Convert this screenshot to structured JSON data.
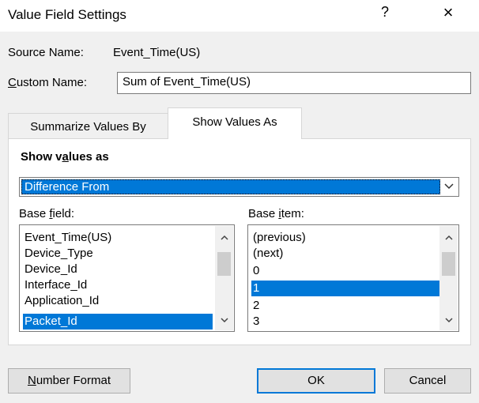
{
  "window": {
    "title": "Value Field Settings",
    "help": "?",
    "close": "×"
  },
  "source": {
    "label": "Source Name:",
    "value": "Event_Time(US)"
  },
  "custom": {
    "label_pre": "",
    "label_u": "C",
    "label_post": "ustom Name:",
    "value": "Sum of Event_Time(US)"
  },
  "tabs": {
    "summarize": "Summarize Values By",
    "show": "Show Values As"
  },
  "show_values": {
    "title_pre": "Show v",
    "title_u": "a",
    "title_post": "lues as",
    "selected": "Difference From",
    "dropdown_icon": "chevron-down"
  },
  "base_field": {
    "label_pre": "Base ",
    "label_u": "f",
    "label_post": "ield:",
    "items": [
      "Event_Time(US)",
      "Device_Type",
      "Device_Id",
      "Interface_Id",
      "Application_Id",
      "Packet_Id"
    ],
    "selected_index": 5
  },
  "base_item": {
    "label_pre": "Base ",
    "label_u": "i",
    "label_post": "tem:",
    "items": [
      "(previous)",
      "(next)",
      "0",
      "1",
      "2",
      "3"
    ],
    "selected_index": 3
  },
  "buttons": {
    "number_format_u": "N",
    "number_format_rest": "umber Format",
    "ok": "OK",
    "cancel": "Cancel"
  },
  "colors": {
    "selection": "#0078d7",
    "dialog_bg": "#f0f0f0"
  }
}
